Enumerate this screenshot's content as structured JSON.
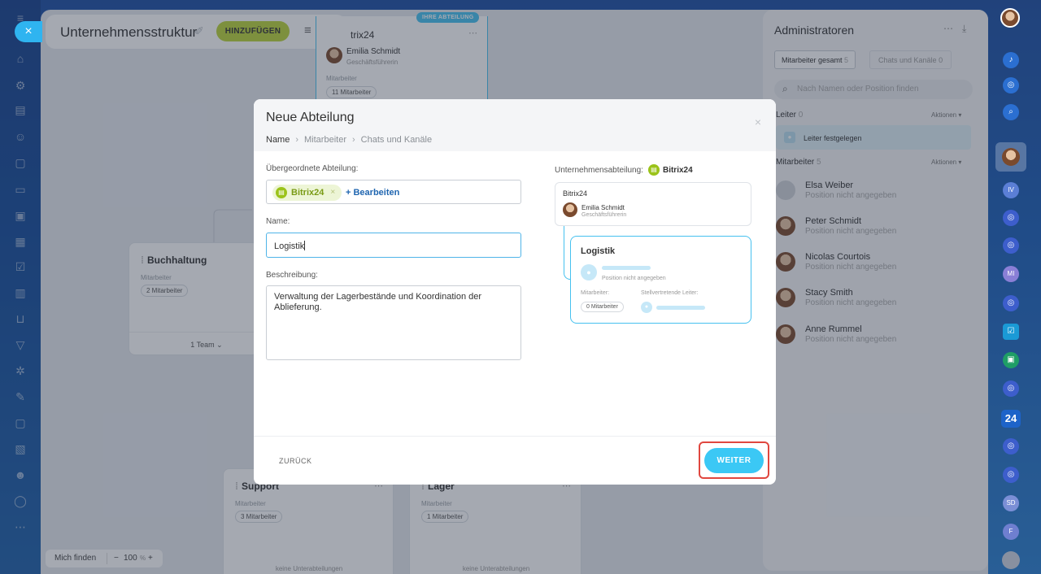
{
  "page": {
    "title": "Unternehmensstruktur",
    "add_button": "HINZUFÜGEN"
  },
  "org": {
    "top_badge": "IHRE ABTEILUNG",
    "top_title": "trix24",
    "top_manager_name": "Emilia Schmidt",
    "top_manager_role": "Geschäftsführerin",
    "top_staff_label": "Mitarbeiter",
    "top_staff_count": "11 Mitarbeiter",
    "card1_title": "Buchhaltung",
    "card1_staff_label": "Mitarbeiter",
    "card1_staff_count": "2 Mitarbeiter",
    "card1_team": "1 Team",
    "card2_title": "Support",
    "card2_staff_label": "Mitarbeiter",
    "card2_staff_count": "3 Mitarbeiter",
    "card2_sub": "keine Unterabteilungen",
    "card3_title": "Lager",
    "card3_staff_label": "Mitarbeiter",
    "card3_staff_count": "1 Mitarbeiter",
    "card3_sub": "keine Unterabteilungen"
  },
  "bottom": {
    "find_me": "Mich finden",
    "zoom_minus": "−",
    "zoom": "100",
    "zoom_unit": "%",
    "zoom_plus": "+"
  },
  "right_panel": {
    "title": "Administratoren",
    "tab_employees": "Mitarbeiter gesamt",
    "tab_employees_count": "5",
    "tab_chats": "Chats und Kanäle",
    "tab_chats_count": "0",
    "search_placeholder": "Nach Namen oder Position finden",
    "leaders_label": "Leiter",
    "leaders_count": "0",
    "actions": "Aktionen",
    "leader_set": "Leiter festgelegen",
    "staff_label": "Mitarbeiter",
    "staff_count": "5",
    "people": [
      {
        "name": "Elsa Weiber",
        "position": "Position nicht angegeben"
      },
      {
        "name": "Peter Schmidt",
        "position": "Position nicht angegeben"
      },
      {
        "name": "Nicolas Courtois",
        "position": "Position nicht angegeben"
      },
      {
        "name": "Stacy Smith",
        "position": "Position nicht angegeben"
      },
      {
        "name": "Anne Rummel",
        "position": "Position nicht angegeben"
      }
    ]
  },
  "right_bar": {
    "items": [
      "IV",
      "MI",
      "24",
      "SD",
      "F"
    ]
  },
  "modal": {
    "title": "Neue Abteilung",
    "steps": [
      "Name",
      "Mitarbeiter",
      "Chats und Kanäle"
    ],
    "parent_label": "Übergeordnete Abteilung:",
    "parent_tag": "Bitrix24",
    "edit_link": "+ Bearbeiten",
    "name_label": "Name:",
    "name_value": "Logistik",
    "desc_label": "Beschreibung:",
    "desc_value": "Verwaltung der Lagerbestände und Koordination der Ablieferung.",
    "preview_label": "Unternehmensabteilung:",
    "preview_company": "Bitrix24",
    "preview_parent_title": "Bitrix24",
    "preview_parent_manager": "Emilia Schmidt",
    "preview_parent_role": "Geschäftsführerin",
    "preview_child_title": "Logistik",
    "preview_position": "Position nicht angegeben",
    "preview_staff_label": "Mitarbeiter:",
    "preview_deputy_label": "Stellvertretende Leiter:",
    "preview_staff_count": "0 Mitarbeiter",
    "back_button": "ZURÜCK",
    "next_button": "WEITER"
  },
  "colors": {
    "accent": "#3bc8f5",
    "add_button": "#bbd43a",
    "highlight": "#e0473f",
    "link": "#2066b0"
  }
}
